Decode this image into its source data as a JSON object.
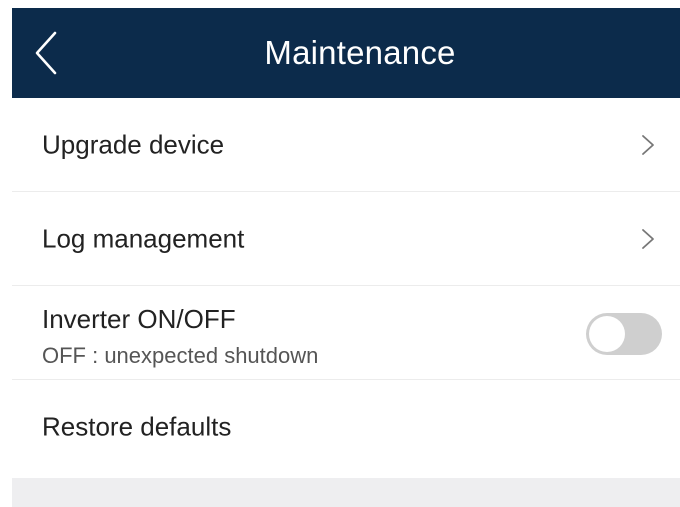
{
  "header": {
    "title": "Maintenance",
    "background_color": "#0c2b4b",
    "back_icon": "chevron-left-icon"
  },
  "items": [
    {
      "label": "Upgrade device",
      "icon": "chevron-right-icon"
    },
    {
      "label": "Log management",
      "icon": "chevron-right-icon"
    },
    {
      "label": "Inverter ON/OFF",
      "sublabel": "OFF : unexpected shutdown",
      "toggle_state": "off"
    },
    {
      "label": "Restore defaults"
    }
  ]
}
